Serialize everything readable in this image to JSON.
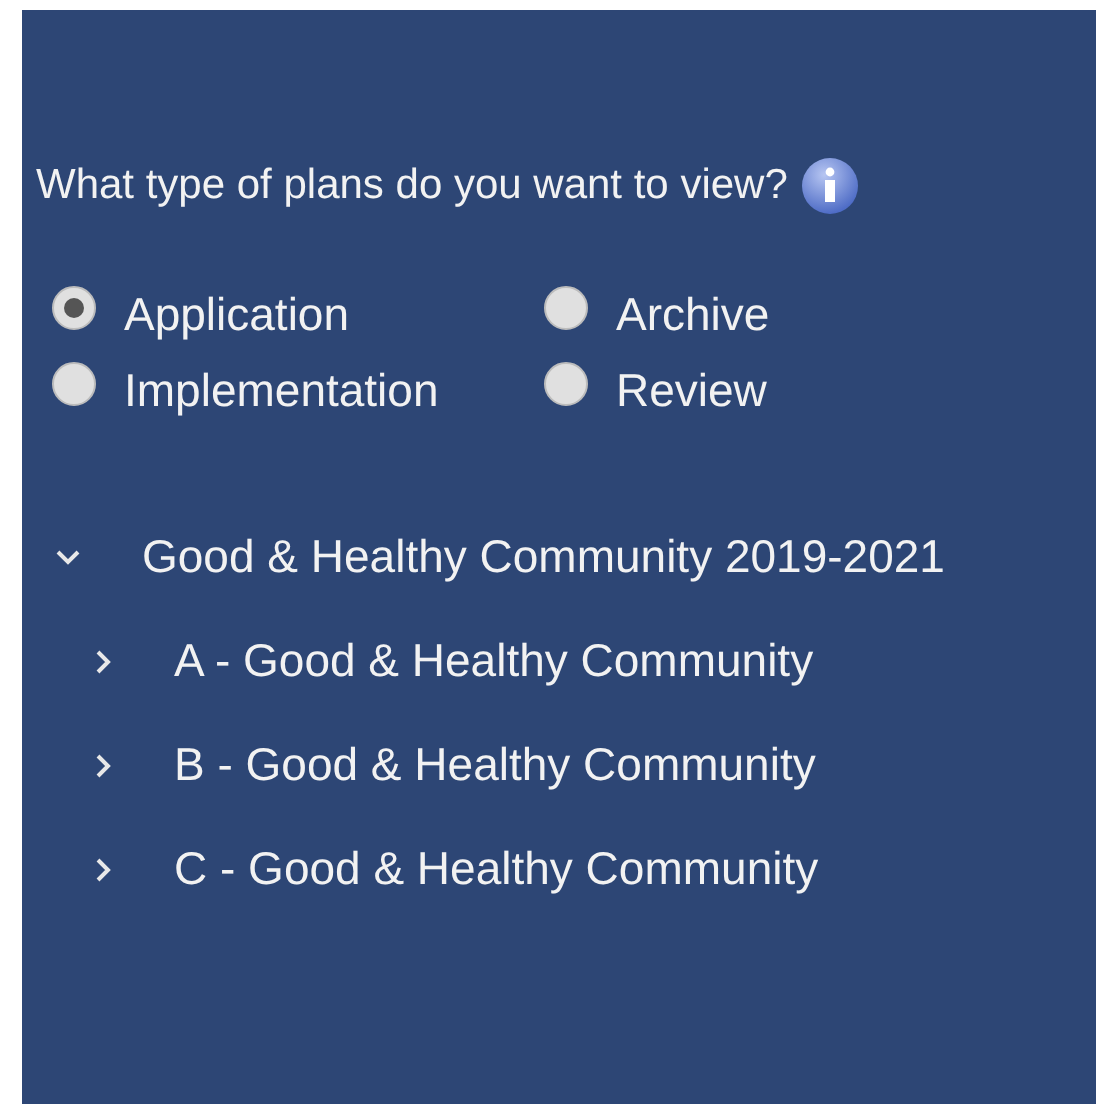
{
  "question": "What type of plans do you want to view?",
  "plan_types": [
    {
      "label": "Application",
      "selected": true
    },
    {
      "label": "Archive",
      "selected": false
    },
    {
      "label": "Implementation",
      "selected": false
    },
    {
      "label": "Review",
      "selected": false
    }
  ],
  "tree": [
    {
      "label": "Good & Healthy Community 2019-2021",
      "expanded": true,
      "children": [
        {
          "label": "A - Good & Healthy Community",
          "expanded": false
        },
        {
          "label": "B - Good & Healthy Community",
          "expanded": false
        },
        {
          "label": "C - Good & Healthy Community",
          "expanded": false
        }
      ]
    }
  ]
}
